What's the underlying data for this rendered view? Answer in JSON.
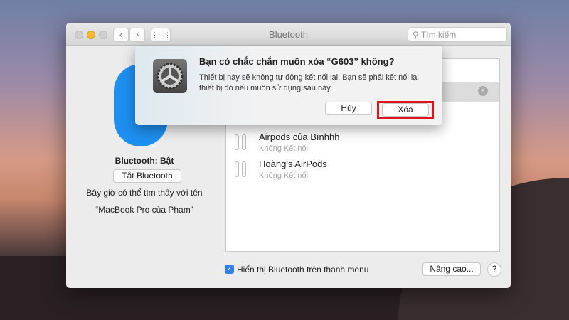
{
  "window": {
    "title": "Bluetooth",
    "search_placeholder": "Tìm kiếm"
  },
  "sidebar": {
    "status": "Bluetooth: Bật",
    "toggle_button": "Tắt Bluetooth",
    "visible_line1": "Bây giờ có thể tìm thấy với tên",
    "visible_line2": "“MacBook Pro của Phạm”"
  },
  "devices": [
    {
      "name": "Airpods của Bìnhhh",
      "status": "Không Kết nối"
    },
    {
      "name": "Hoàng’s AirPods",
      "status": "Không Kết nối"
    }
  ],
  "footer": {
    "show_in_menu_label": "Hiển thị Bluetooth trên thanh menu",
    "show_in_menu_checked": true,
    "advanced_button": "Nâng cao...",
    "help_button": "?"
  },
  "dialog": {
    "title": "Bạn có chắc chắn muốn xóa “G603” không?",
    "message": "Thiết bị này sẽ không tự động kết nối lại. Bạn sẽ phải kết nối lại thiết bị đó nếu muốn sử dụng sau này.",
    "cancel_button": "Hủy",
    "confirm_button": "Xóa",
    "highlight_color": "#e0141e"
  }
}
